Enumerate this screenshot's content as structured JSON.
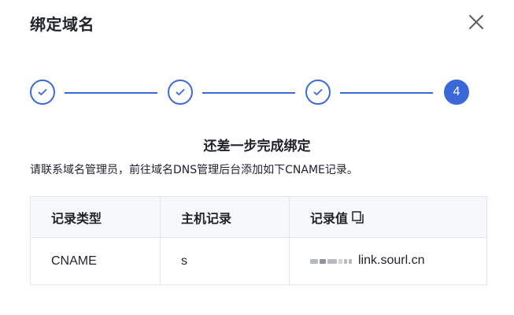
{
  "modal": {
    "title": "绑定域名"
  },
  "steps": {
    "current_step": "4"
  },
  "status": {
    "heading": "还差一步完成绑定",
    "instruction": "请联系域名管理员，前往域名DNS管理后台添加如下CNAME记录。"
  },
  "table": {
    "headers": [
      "记录类型",
      "主机记录",
      "记录值"
    ],
    "rows": [
      {
        "type": "CNAME",
        "host": "s",
        "value": "link.sourl.cn"
      }
    ]
  },
  "colors": {
    "accent": "#3a68d8",
    "header_bg": "#f7f8fa",
    "border": "#e5e6eb"
  },
  "icons": {
    "close": "close-icon",
    "step_done": "check-icon",
    "copy": "copy-icon"
  }
}
